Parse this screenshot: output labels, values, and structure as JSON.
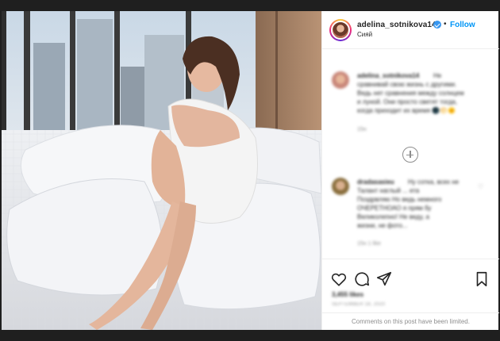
{
  "header": {
    "username": "adelina_sotnikova14",
    "follow_label": "Follow",
    "separator": "•",
    "location": "Сияй"
  },
  "comments": [
    {
      "username": "adelina_sotnikova14",
      "lines": [
        "Не",
        "сравнивай свою жизнь с другими.",
        "Ведь нет сравнения между солнцем",
        "и луной. Они просто светят тогда,",
        "когда приходит их время 🌑🌕🌞"
      ],
      "meta": "15н"
    },
    {
      "username": "dradasasieu",
      "lines": [
        "Ну сотка, всех не",
        "Талант наглый ... ета",
        "Поздрвляю Но ведь немного",
        "ОЧЕРЕТНОАО я прям бу",
        "Великолепно! Не веду, а",
        "жизни, не фото..."
      ],
      "meta": "15н   1 like"
    }
  ],
  "actions": {
    "likes": "3,455 likes",
    "date": "SEPTEMBER 18, 2020"
  },
  "footer": {
    "limited_text": "Comments on this post have been limited."
  },
  "icons": {
    "like": "heart-icon",
    "comment": "comment-bubble-icon",
    "share": "paper-plane-icon",
    "save": "bookmark-icon",
    "more": "plus-circle-icon"
  },
  "colors": {
    "link": "#0095f6",
    "text": "#262626",
    "muted": "#8e8e8e",
    "background": "#1f1f1f"
  }
}
